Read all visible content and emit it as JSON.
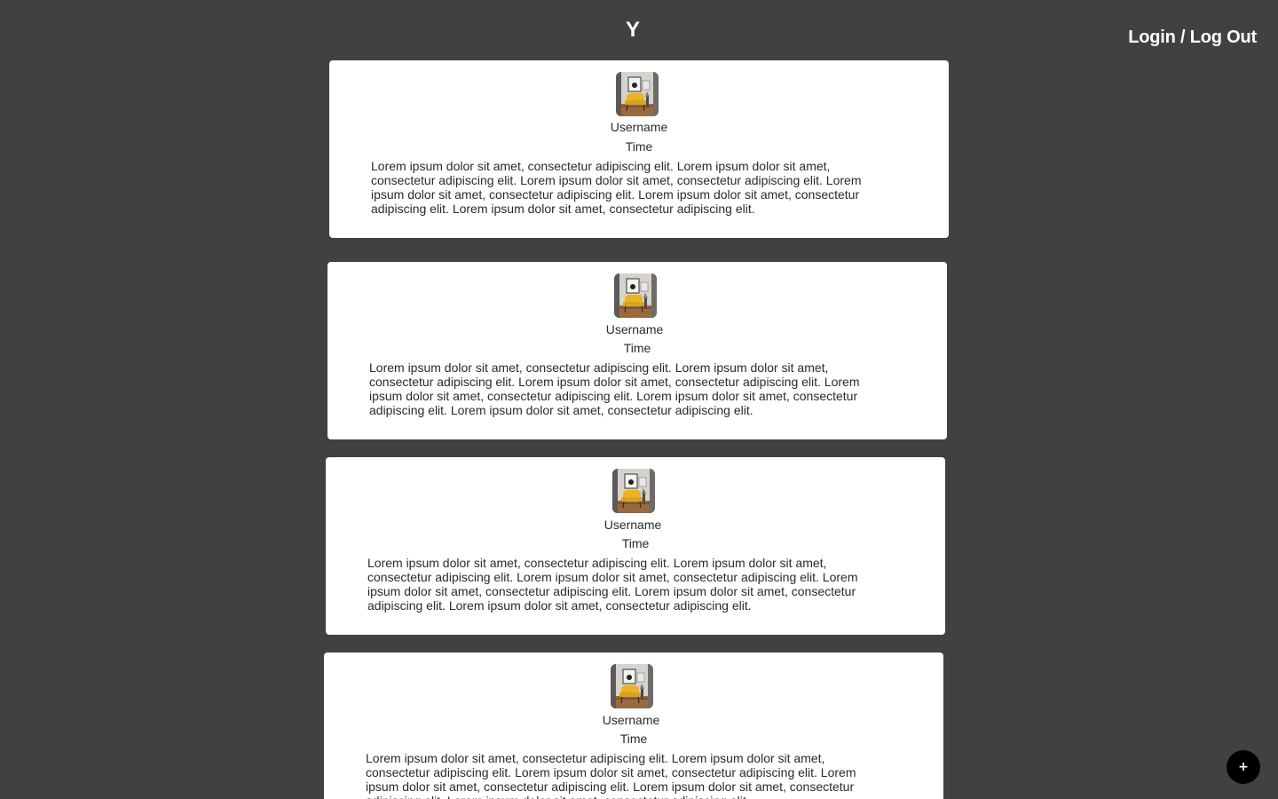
{
  "header": {
    "logo": "Y",
    "auth_link": "Login / Log Out"
  },
  "posts": [
    {
      "username": "Username",
      "time": "Time",
      "text": "Lorem ipsum dolor sit amet, consectetur adipiscing elit. Lorem ipsum dolor sit amet, consectetur adipiscing elit. Lorem ipsum dolor sit amet, consectetur adipiscing elit. Lorem ipsum dolor sit amet, consectetur adipiscing elit. Lorem ipsum dolor sit amet, consectetur adipiscing elit. Lorem ipsum dolor sit amet, consectetur adipiscing elit."
    },
    {
      "username": "Username",
      "time": "Time",
      "text": "Lorem ipsum dolor sit amet, consectetur adipiscing elit. Lorem ipsum dolor sit amet, consectetur adipiscing elit. Lorem ipsum dolor sit amet, consectetur adipiscing elit. Lorem ipsum dolor sit amet, consectetur adipiscing elit. Lorem ipsum dolor sit amet, consectetur adipiscing elit. Lorem ipsum dolor sit amet, consectetur adipiscing elit."
    },
    {
      "username": "Username",
      "time": "Time",
      "text": "Lorem ipsum dolor sit amet, consectetur adipiscing elit. Lorem ipsum dolor sit amet, consectetur adipiscing elit. Lorem ipsum dolor sit amet, consectetur adipiscing elit. Lorem ipsum dolor sit amet, consectetur adipiscing elit. Lorem ipsum dolor sit amet, consectetur adipiscing elit. Lorem ipsum dolor sit amet, consectetur adipiscing elit."
    },
    {
      "username": "Username",
      "time": "Time",
      "text": "Lorem ipsum dolor sit amet, consectetur adipiscing elit. Lorem ipsum dolor sit amet, consectetur adipiscing elit. Lorem ipsum dolor sit amet, consectetur adipiscing elit. Lorem ipsum dolor sit amet, consectetur adipiscing elit. Lorem ipsum dolor sit amet, consectetur adipiscing elit. Lorem ipsum dolor sit amet, consectetur adipiscing elit."
    }
  ],
  "fab": {
    "label": "+"
  },
  "colors": {
    "background": "#414141",
    "card": "#ffffff",
    "fab": "#000000",
    "chair": "#e8b324"
  },
  "icons": {
    "avatar": "avatar-photo-yellow-chair"
  }
}
